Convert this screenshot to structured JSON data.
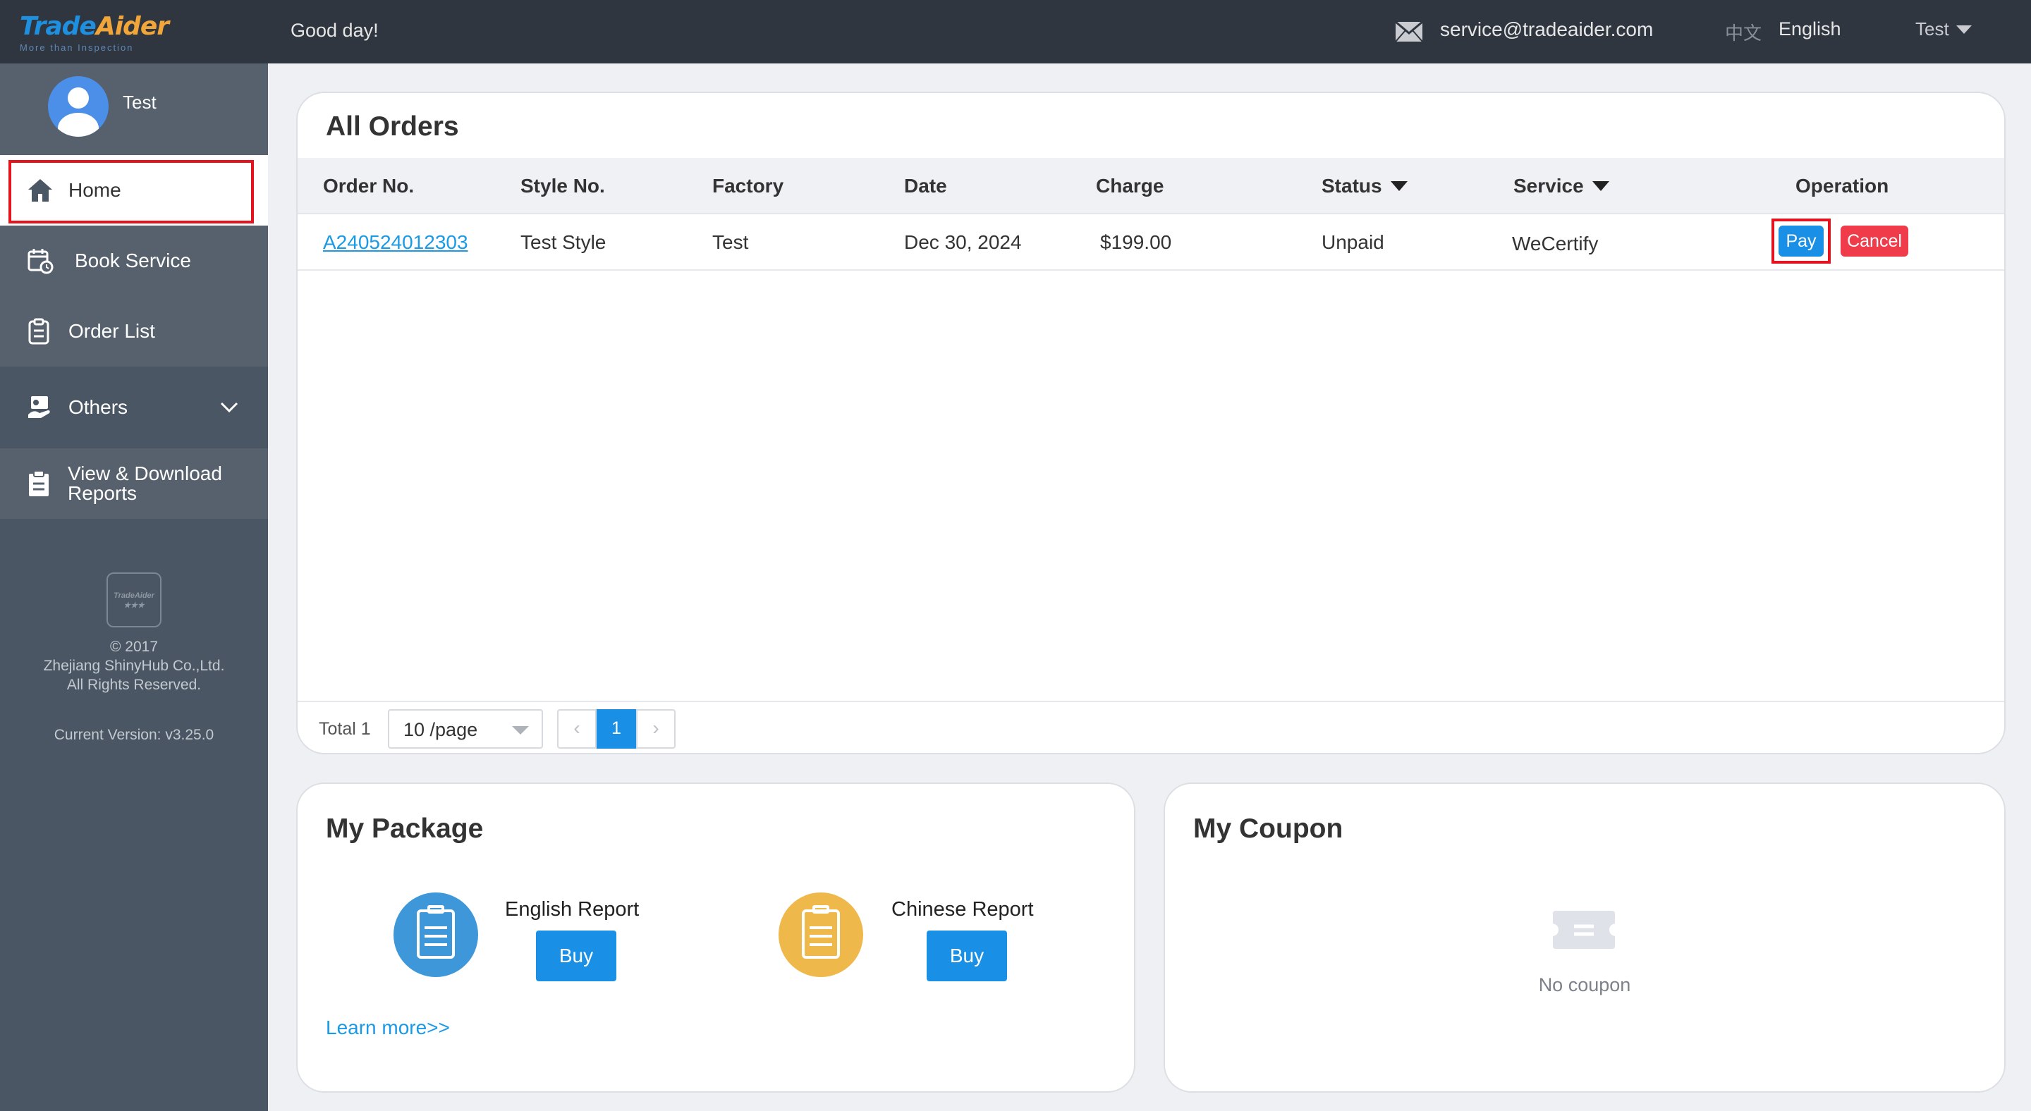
{
  "brand": {
    "name_part1": "Trade",
    "name_part2": "Aider",
    "tagline": "More than Inspection"
  },
  "header": {
    "greeting": "Good day!",
    "email": "service@tradeaider.com",
    "lang_zh": "中文",
    "lang_en": "English",
    "user": "Test"
  },
  "sidebar": {
    "profile_name": "Test",
    "items": [
      {
        "label": "Home"
      },
      {
        "label": "Book Service"
      },
      {
        "label": "Order List"
      },
      {
        "label": "Others"
      },
      {
        "label_line1": "View & Download",
        "label_line2": "Reports"
      }
    ],
    "footer": {
      "logo_text": "TradeAider",
      "copyright": "© 2017",
      "company": "Zhejiang ShinyHub Co.,Ltd.",
      "rights": "All Rights Reserved.",
      "version": "Current Version: v3.25.0"
    }
  },
  "orders": {
    "title": "All Orders",
    "columns": [
      "Order No.",
      "Style No.",
      "Factory",
      "Date",
      "Charge",
      "Status",
      "Service",
      "Operation"
    ],
    "rows": [
      {
        "order_no": "A240524012303",
        "style_no": "Test Style",
        "factory": "Test",
        "date": "Dec 30, 2024",
        "charge": "$199.00",
        "status": "Unpaid",
        "service": "WeCertify",
        "pay_label": "Pay",
        "cancel_label": "Cancel"
      }
    ],
    "pager": {
      "total": "Total 1",
      "per_page": "10 /page",
      "prev": "‹",
      "current": "1",
      "next": "›"
    }
  },
  "package": {
    "title": "My Package",
    "items": [
      {
        "name": "English Report",
        "buy": "Buy",
        "color": "#3d97d9"
      },
      {
        "name": "Chinese Report",
        "buy": "Buy",
        "color": "#efb84a"
      }
    ],
    "learn_more": "Learn more>>"
  },
  "coupon": {
    "title": "My Coupon",
    "empty": "No coupon"
  },
  "colors": {
    "topbar": "#2f3640",
    "sidebar": "#4a5663",
    "primary": "#1990e6",
    "danger": "#ef3b4a",
    "highlight": "#e3141d"
  }
}
